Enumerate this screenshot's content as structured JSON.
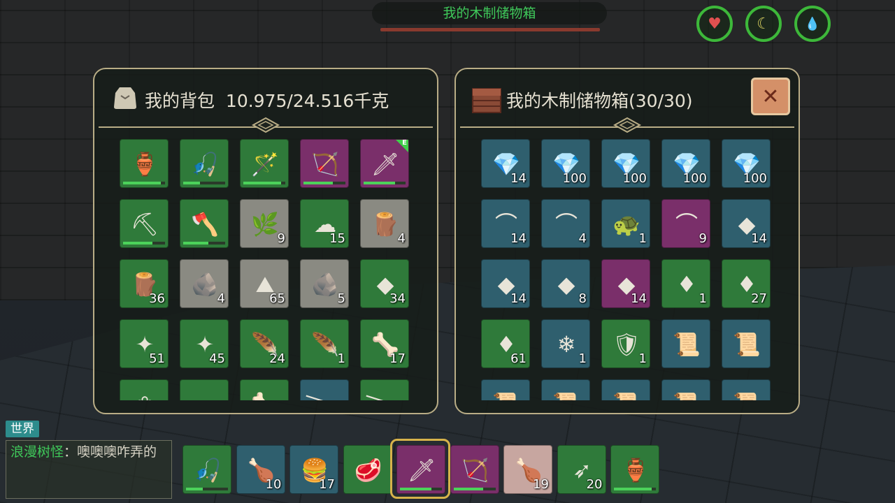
{
  "hud": {
    "container_title": "我的木制储物箱",
    "stats": [
      {
        "name": "health",
        "glyph": "♥",
        "color": "#e05050"
      },
      {
        "name": "hunger",
        "glyph": "☾",
        "color": "#d8d060"
      },
      {
        "name": "thirst",
        "glyph": "💧",
        "color": "#3fb8c8"
      }
    ]
  },
  "backpack": {
    "label": "我的背包",
    "weight": "10.975/24.516千克",
    "slots": [
      {
        "icon": "gourd-flask-icon",
        "glyph": "🏺",
        "bg": "green",
        "qty": "",
        "durability": 0.9
      },
      {
        "icon": "fishing-rod-icon",
        "glyph": "🎣",
        "bg": "green",
        "qty": "",
        "durability": 0.4
      },
      {
        "icon": "magic-staff-icon",
        "glyph": "🪄",
        "bg": "green",
        "qty": "",
        "durability": 0.9
      },
      {
        "icon": "bow-icon",
        "glyph": "🏹",
        "bg": "purple",
        "qty": "",
        "durability": 0.7
      },
      {
        "icon": "curved-blade-icon",
        "glyph": "🗡",
        "bg": "purple",
        "qty": "",
        "durability": 0.75,
        "equipped": "E"
      },
      {
        "icon": "pickaxe-icon",
        "glyph": "⛏",
        "bg": "green",
        "qty": "",
        "durability": 0.7
      },
      {
        "icon": "battle-axe-icon",
        "glyph": "🪓",
        "bg": "green",
        "qty": "",
        "durability": 0.6
      },
      {
        "icon": "plant-fiber-icon",
        "glyph": "🌿",
        "bg": "gray",
        "qty": "9"
      },
      {
        "icon": "cotton-icon",
        "glyph": "☁",
        "bg": "green",
        "qty": "15"
      },
      {
        "icon": "wood-bundle-icon",
        "glyph": "🪵",
        "bg": "gray",
        "qty": "4"
      },
      {
        "icon": "tree-stump-icon",
        "glyph": "🪵",
        "bg": "green",
        "qty": "36"
      },
      {
        "icon": "copper-ore-icon",
        "glyph": "🪨",
        "bg": "gray",
        "qty": "4"
      },
      {
        "icon": "sand-pile-icon",
        "glyph": "⛰",
        "bg": "gray",
        "qty": "65"
      },
      {
        "icon": "iron-ore-icon",
        "glyph": "🪨",
        "bg": "gray",
        "qty": "5"
      },
      {
        "icon": "coal-icon",
        "glyph": "◆",
        "bg": "green",
        "qty": "34"
      },
      {
        "icon": "spirit-orb-icon",
        "glyph": "✦",
        "bg": "green",
        "qty": "51"
      },
      {
        "icon": "spirit-orb-icon",
        "glyph": "✦",
        "bg": "green",
        "qty": "45"
      },
      {
        "icon": "orange-feather-icon",
        "glyph": "🪶",
        "bg": "green",
        "qty": "24"
      },
      {
        "icon": "blue-feather-icon",
        "glyph": "🪶",
        "bg": "green",
        "qty": "1"
      },
      {
        "icon": "leather-hide-icon",
        "glyph": "🦴",
        "bg": "green",
        "qty": "17"
      },
      {
        "icon": "white-flower-icon",
        "glyph": "❀",
        "bg": "green",
        "qty": ""
      },
      {
        "icon": "stone-block-icon",
        "glyph": "▱",
        "bg": "green",
        "qty": ""
      },
      {
        "icon": "bone-icon",
        "glyph": "🦴",
        "bg": "green",
        "qty": ""
      },
      {
        "icon": "horn-icon",
        "glyph": "𐃆",
        "bg": "blue",
        "qty": ""
      },
      {
        "icon": "tusk-icon",
        "glyph": "𐃆",
        "bg": "green",
        "qty": ""
      }
    ]
  },
  "chest": {
    "label": "我的木制储物箱(30/30)",
    "slots": [
      {
        "icon": "purple-crystal-icon",
        "glyph": "💎",
        "bg": "blue",
        "qty": "14"
      },
      {
        "icon": "purple-crystal-icon",
        "glyph": "💎",
        "bg": "blue",
        "qty": "100"
      },
      {
        "icon": "purple-crystal-icon",
        "glyph": "💎",
        "bg": "blue",
        "qty": "100"
      },
      {
        "icon": "purple-crystal-icon",
        "glyph": "💎",
        "bg": "blue",
        "qty": "100"
      },
      {
        "icon": "purple-crystal-icon",
        "glyph": "💎",
        "bg": "blue",
        "qty": "100"
      },
      {
        "icon": "curved-horn-icon",
        "glyph": "⌒",
        "bg": "blue",
        "qty": "14"
      },
      {
        "icon": "tusk-icon",
        "glyph": "⌒",
        "bg": "blue",
        "qty": "4"
      },
      {
        "icon": "turtle-shell-icon",
        "glyph": "🐢",
        "bg": "blue",
        "qty": "1"
      },
      {
        "icon": "white-fang-icon",
        "glyph": "⌒",
        "bg": "purple",
        "qty": "9"
      },
      {
        "icon": "magenta-gem-icon",
        "glyph": "◆",
        "bg": "blue",
        "qty": "14"
      },
      {
        "icon": "cyan-gem-icon",
        "glyph": "◆",
        "bg": "blue",
        "qty": "14"
      },
      {
        "icon": "red-gem-icon",
        "glyph": "◆",
        "bg": "blue",
        "qty": "8"
      },
      {
        "icon": "blue-gem-icon",
        "glyph": "◆",
        "bg": "purple",
        "qty": "14"
      },
      {
        "icon": "ruby-icon",
        "glyph": "♦",
        "bg": "green",
        "qty": "1"
      },
      {
        "icon": "topaz-icon",
        "glyph": "♦",
        "bg": "green",
        "qty": "27"
      },
      {
        "icon": "aquamarine-shard-icon",
        "glyph": "♦",
        "bg": "green",
        "qty": "61"
      },
      {
        "icon": "ice-crystal-icon",
        "glyph": "❄",
        "bg": "blue",
        "qty": "1"
      },
      {
        "icon": "saddle-icon",
        "glyph": "🛡",
        "bg": "green",
        "qty": "1"
      },
      {
        "icon": "blueprint-scroll-icon",
        "glyph": "📜",
        "bg": "blue",
        "qty": ""
      },
      {
        "icon": "blueprint-scroll-icon",
        "glyph": "📜",
        "bg": "blue",
        "qty": ""
      },
      {
        "icon": "blueprint-scroll-icon",
        "glyph": "📜",
        "bg": "blue",
        "qty": ""
      },
      {
        "icon": "blueprint-scroll-icon",
        "glyph": "📜",
        "bg": "blue",
        "qty": ""
      },
      {
        "icon": "blueprint-scroll-icon",
        "glyph": "📜",
        "bg": "blue",
        "qty": ""
      },
      {
        "icon": "blueprint-scroll-icon",
        "glyph": "📜",
        "bg": "blue",
        "qty": ""
      },
      {
        "icon": "blueprint-scroll-icon",
        "glyph": "📜",
        "bg": "blue",
        "qty": ""
      }
    ]
  },
  "chat": {
    "tab_label": "世界",
    "sender": "浪漫树怪",
    "separator": "：",
    "message": "噢噢噢咋弄的"
  },
  "hotbar": [
    {
      "icon": "fishing-rod-icon",
      "glyph": "🎣",
      "bg": "green",
      "qty": "",
      "durability": 0.4
    },
    {
      "icon": "meat-drumstick-icon",
      "glyph": "🍗",
      "bg": "blue",
      "qty": "10"
    },
    {
      "icon": "sandwich-icon",
      "glyph": "🍔",
      "bg": "blue",
      "qty": "17"
    },
    {
      "icon": "cooked-meat-icon",
      "glyph": "🥩",
      "bg": "green",
      "qty": ""
    },
    {
      "icon": "curved-blade-icon",
      "glyph": "🗡",
      "bg": "purple",
      "qty": "",
      "durability": 0.75
    },
    {
      "icon": "bow-icon",
      "glyph": "🏹",
      "bg": "purple",
      "qty": "",
      "durability": 0.7
    },
    {
      "icon": "meat-drumstick-icon",
      "glyph": "🍗",
      "bg": "pink",
      "qty": "19"
    },
    {
      "icon": "arrows-icon",
      "glyph": "➶",
      "bg": "green",
      "qty": "20"
    },
    {
      "icon": "gourd-flask-icon",
      "glyph": "🏺",
      "bg": "green",
      "qty": "",
      "durability": 0.9
    }
  ],
  "hotbar_selected_index": 4,
  "close_label": "✕"
}
